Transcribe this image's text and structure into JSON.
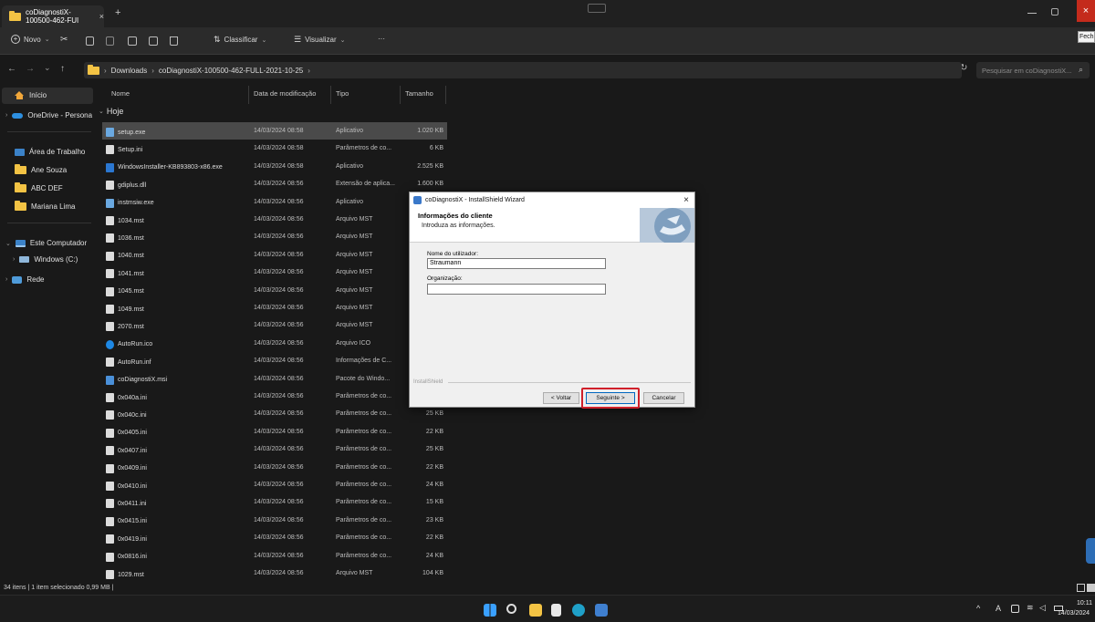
{
  "explorer": {
    "tab_title": "coDiagnostiX-100500-462-FUI",
    "tab_close": "×",
    "new_tab": "+",
    "toolbar": {
      "new_label": "Novo",
      "sort_label": "Classificar",
      "view_label": "Visualizar",
      "more_label": "···"
    },
    "close_tooltip": "Fech",
    "breadcrumb": {
      "items": [
        "Downloads",
        "coDiagnostiX-100500-462-FULL-2021-10-25"
      ]
    },
    "search_placeholder": "Pesquisar em coDiagnostiX...",
    "nav": {
      "home": "Início",
      "onedrive": "OneDrive - Persona",
      "desktop": "Área de Trabalho",
      "user1": "Ane Souza",
      "user2": "ABC DEF",
      "user3": "Mariana Lima",
      "this_pc": "Este Computador",
      "windows_c": "Windows (C:)",
      "network": "Rede"
    },
    "columns": {
      "name": "Nome",
      "date": "Data de modificação",
      "type": "Tipo",
      "size": "Tamanho"
    },
    "group_label": "Hoje",
    "files": [
      {
        "name": "setup.exe",
        "date": "14/03/2024 08:58",
        "type": "Aplicativo",
        "size": "1.020 KB",
        "icon": "exe"
      },
      {
        "name": "Setup.ini",
        "date": "14/03/2024 08:58",
        "type": "Parâmetros de co...",
        "size": "6 KB",
        "icon": "file"
      },
      {
        "name": "WindowsInstaller-KB893803-x86.exe",
        "date": "14/03/2024 08:58",
        "type": "Aplicativo",
        "size": "2.525 KB",
        "icon": "win"
      },
      {
        "name": "gdiplus.dll",
        "date": "14/03/2024 08:56",
        "type": "Extensão de aplica...",
        "size": "1.600 KB",
        "icon": "file"
      },
      {
        "name": "instmsiw.exe",
        "date": "14/03/2024 08:56",
        "type": "Aplicativo",
        "size": "",
        "icon": "exe"
      },
      {
        "name": "1034.mst",
        "date": "14/03/2024 08:56",
        "type": "Arquivo MST",
        "size": "",
        "icon": "file"
      },
      {
        "name": "1036.mst",
        "date": "14/03/2024 08:56",
        "type": "Arquivo MST",
        "size": "",
        "icon": "file"
      },
      {
        "name": "1040.mst",
        "date": "14/03/2024 08:56",
        "type": "Arquivo MST",
        "size": "",
        "icon": "file"
      },
      {
        "name": "1041.mst",
        "date": "14/03/2024 08:56",
        "type": "Arquivo MST",
        "size": "",
        "icon": "file"
      },
      {
        "name": "1045.mst",
        "date": "14/03/2024 08:56",
        "type": "Arquivo MST",
        "size": "",
        "icon": "file"
      },
      {
        "name": "1049.mst",
        "date": "14/03/2024 08:56",
        "type": "Arquivo MST",
        "size": "",
        "icon": "file"
      },
      {
        "name": "2070.mst",
        "date": "14/03/2024 08:56",
        "type": "Arquivo MST",
        "size": "",
        "icon": "file"
      },
      {
        "name": "AutoRun.ico",
        "date": "14/03/2024 08:56",
        "type": "Arquivo ICO",
        "size": "",
        "icon": "ico"
      },
      {
        "name": "AutoRun.inf",
        "date": "14/03/2024 08:56",
        "type": "Informações de C...",
        "size": "",
        "icon": "file"
      },
      {
        "name": "coDiagnostiX.msi",
        "date": "14/03/2024 08:56",
        "type": "Pacote do Windo...",
        "size": "",
        "icon": "msi"
      },
      {
        "name": "0x040a.ini",
        "date": "14/03/2024 08:56",
        "type": "Parâmetros de co...",
        "size": "",
        "icon": "file"
      },
      {
        "name": "0x040c.ini",
        "date": "14/03/2024 08:56",
        "type": "Parâmetros de co...",
        "size": "25 KB",
        "icon": "file"
      },
      {
        "name": "0x0405.ini",
        "date": "14/03/2024 08:56",
        "type": "Parâmetros de co...",
        "size": "22 KB",
        "icon": "file"
      },
      {
        "name": "0x0407.ini",
        "date": "14/03/2024 08:56",
        "type": "Parâmetros de co...",
        "size": "25 KB",
        "icon": "file"
      },
      {
        "name": "0x0409.ini",
        "date": "14/03/2024 08:56",
        "type": "Parâmetros de co...",
        "size": "22 KB",
        "icon": "file"
      },
      {
        "name": "0x0410.ini",
        "date": "14/03/2024 08:56",
        "type": "Parâmetros de co...",
        "size": "24 KB",
        "icon": "file"
      },
      {
        "name": "0x0411.ini",
        "date": "14/03/2024 08:56",
        "type": "Parâmetros de co...",
        "size": "15 KB",
        "icon": "file"
      },
      {
        "name": "0x0415.ini",
        "date": "14/03/2024 08:56",
        "type": "Parâmetros de co...",
        "size": "23 KB",
        "icon": "file"
      },
      {
        "name": "0x0419.ini",
        "date": "14/03/2024 08:56",
        "type": "Parâmetros de co...",
        "size": "22 KB",
        "icon": "file"
      },
      {
        "name": "0x0816.ini",
        "date": "14/03/2024 08:56",
        "type": "Parâmetros de co...",
        "size": "24 KB",
        "icon": "file"
      },
      {
        "name": "1029.mst",
        "date": "14/03/2024 08:56",
        "type": "Arquivo MST",
        "size": "104 KB",
        "icon": "file"
      }
    ],
    "status": "34 itens  |  1 item selecionado  0,99 MB  |"
  },
  "dialog": {
    "title": "coDiagnostiX - InstallShield Wizard",
    "close": "×",
    "heading": "Informações do cliente",
    "subheading": "Introduza as informações.",
    "user_label": "Nome do utilizador:",
    "user_value": "Straumann",
    "org_label": "Organização:",
    "org_value": "",
    "brand": "InstallShield",
    "back_label": "< Voltar",
    "next_label": "Seguinte >",
    "cancel_label": "Cancelar"
  },
  "taskbar": {
    "time": "10:11",
    "date": "14/03/2024",
    "lang": "A"
  },
  "colors": {
    "accent": "#0067c0",
    "highlight": "#d0202a",
    "selected_row": "#4a4a4a"
  }
}
